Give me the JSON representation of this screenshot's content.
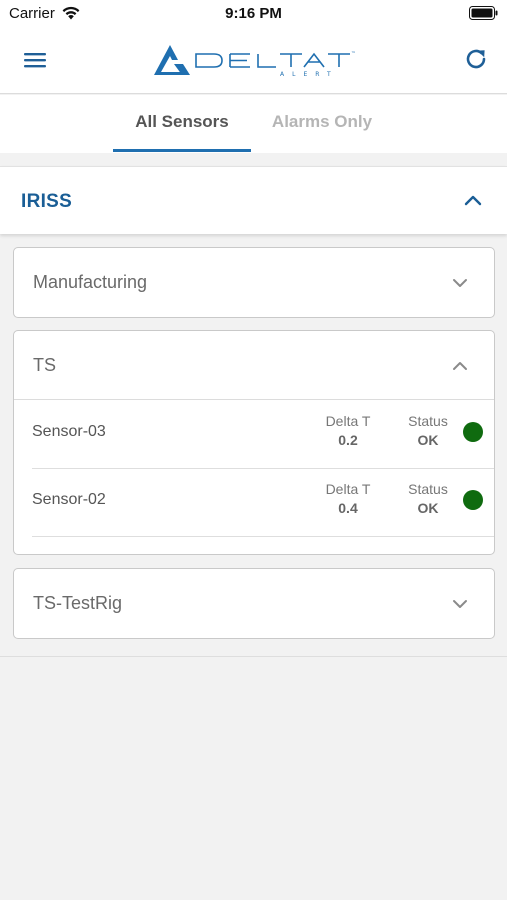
{
  "status_bar": {
    "carrier": "Carrier",
    "time": "9:16 PM"
  },
  "header": {
    "logo_icon": "delta-t-alert-logo",
    "menu_icon": "hamburger-menu-icon",
    "refresh_icon": "refresh-icon"
  },
  "tabs": [
    {
      "label": "All Sensors",
      "active": true
    },
    {
      "label": "Alarms Only",
      "active": false
    }
  ],
  "group": {
    "title": "IRISS",
    "expanded": true,
    "cards": [
      {
        "title": "Manufacturing",
        "expanded": false
      },
      {
        "title": "TS",
        "expanded": true,
        "sensors": [
          {
            "name": "Sensor-03",
            "delta_label": "Delta T",
            "delta_value": "0.2",
            "status_label": "Status",
            "status_value": "OK",
            "status_color": "#0f6b0f"
          },
          {
            "name": "Sensor-02",
            "delta_label": "Delta T",
            "delta_value": "0.4",
            "status_label": "Status",
            "status_value": "OK",
            "status_color": "#0f6b0f"
          }
        ]
      },
      {
        "title": "TS-TestRig",
        "expanded": false
      }
    ]
  },
  "colors": {
    "accent": "#1f6fb0",
    "group_title": "#1a5e96",
    "status_ok": "#0f6b0f"
  }
}
